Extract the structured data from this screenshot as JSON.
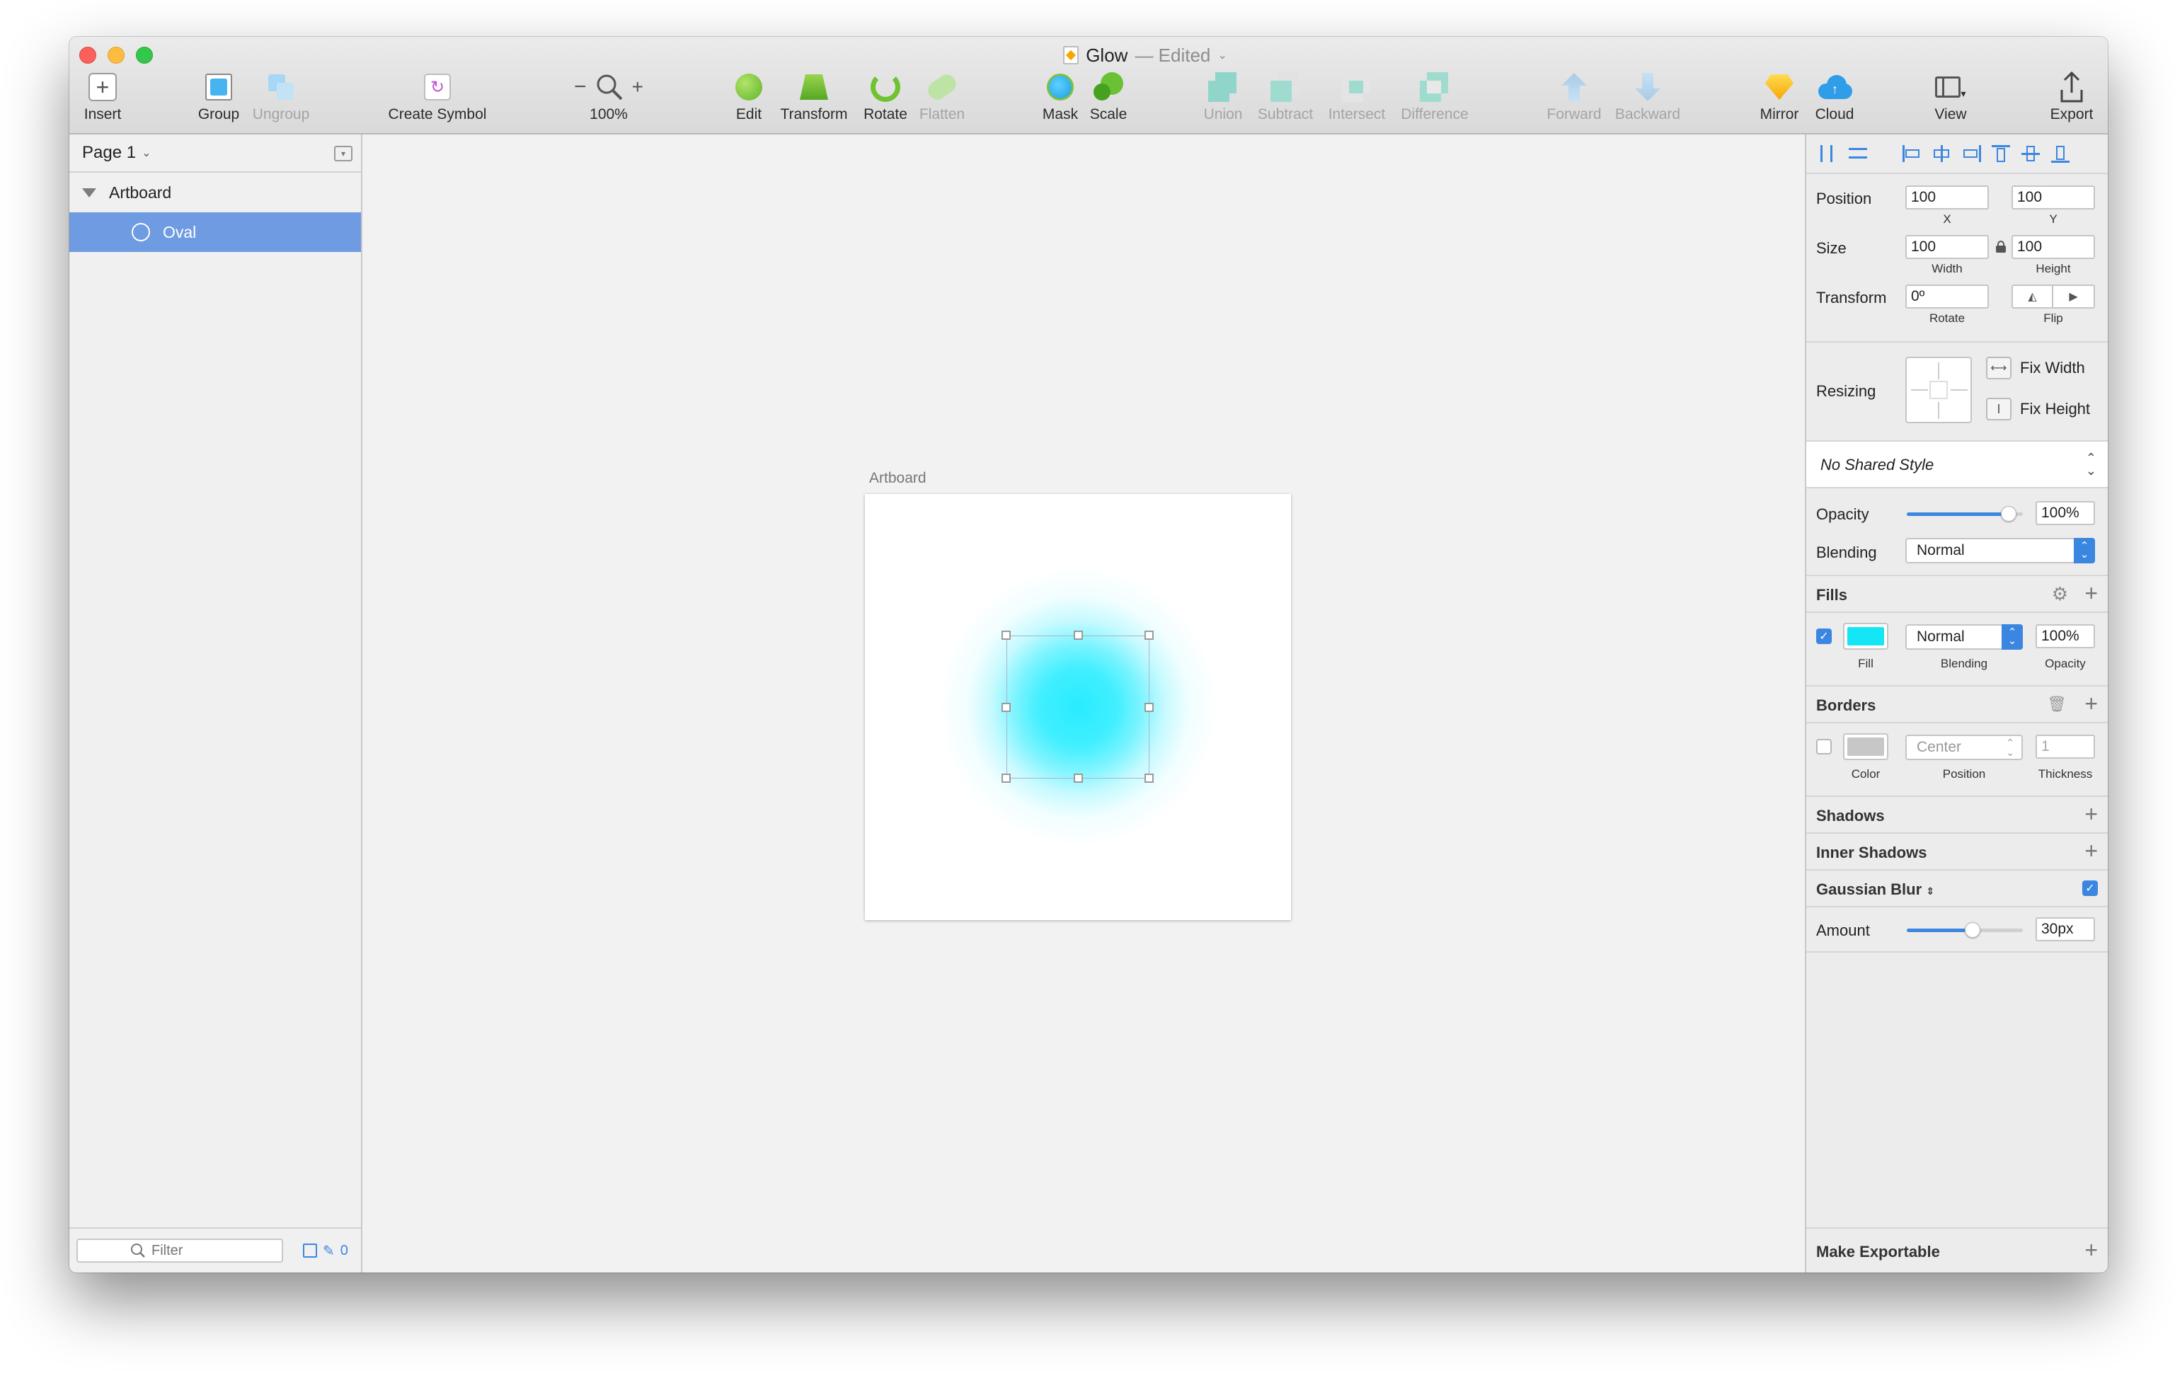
{
  "window": {
    "doc_title": "Glow",
    "edited_suffix": "— Edited"
  },
  "toolbar": {
    "insert": "Insert",
    "group": "Group",
    "ungroup": "Ungroup",
    "create_symbol": "Create Symbol",
    "zoom": "100%",
    "edit": "Edit",
    "transform": "Transform",
    "rotate": "Rotate",
    "flatten": "Flatten",
    "mask": "Mask",
    "scale": "Scale",
    "union": "Union",
    "subtract": "Subtract",
    "intersect": "Intersect",
    "difference": "Difference",
    "forward": "Forward",
    "backward": "Backward",
    "mirror": "Mirror",
    "cloud": "Cloud",
    "view": "View",
    "export": "Export"
  },
  "layers": {
    "page": "Page 1",
    "artboard": "Artboard",
    "oval": "Oval",
    "filter_placeholder": "Filter",
    "slice_count": "0"
  },
  "canvas": {
    "artboard_label": "Artboard",
    "fill_color": "#29ecff"
  },
  "inspector": {
    "position_label": "Position",
    "x": "100",
    "y": "100",
    "x_label": "X",
    "y_label": "Y",
    "size_label": "Size",
    "width": "100",
    "height": "100",
    "width_label": "Width",
    "height_label": "Height",
    "transform_label": "Transform",
    "rotate": "0º",
    "rotate_label": "Rotate",
    "flip_label": "Flip",
    "resizing_label": "Resizing",
    "fix_width": "Fix Width",
    "fix_height": "Fix Height",
    "shared_style": "No Shared Style",
    "opacity_label": "Opacity",
    "opacity": "100%",
    "opacity_fraction": 0.88,
    "blending_label": "Blending",
    "blending": "Normal",
    "fills_title": "Fills",
    "fill_enabled": true,
    "fill_color": "#14e6f5",
    "fill_blending": "Normal",
    "fill_opacity": "100%",
    "fill_label": "Fill",
    "fill_blending_label": "Blending",
    "fill_opacity_label": "Opacity",
    "borders_title": "Borders",
    "border_color": "#c7c7c7",
    "border_position": "Center",
    "border_thickness": "1",
    "border_color_label": "Color",
    "border_position_label": "Position",
    "border_thickness_label": "Thickness",
    "shadows_title": "Shadows",
    "inner_shadows_title": "Inner Shadows",
    "blur_title": "Gaussian Blur",
    "amount_label": "Amount",
    "amount": "30px",
    "amount_fraction": 0.57,
    "make_exportable": "Make Exportable",
    "accent": "#3b86e0"
  }
}
